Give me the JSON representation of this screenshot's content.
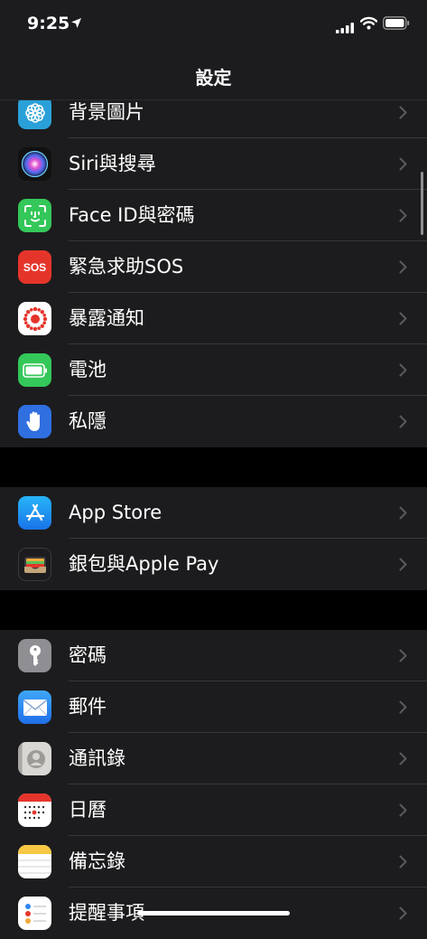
{
  "status_bar": {
    "time": "9:25"
  },
  "nav": {
    "title": "設定"
  },
  "groups": [
    {
      "items": [
        {
          "label": "背景圖片",
          "icon": "wallpaper-icon",
          "color": "#2aa0d8"
        },
        {
          "label": "Siri與搜尋",
          "icon": "siri-icon",
          "color": "#1c1c2e"
        },
        {
          "label": "Face ID與密碼",
          "icon": "face-id-icon",
          "color": "#34c759"
        },
        {
          "label": "緊急求助SOS",
          "icon": "sos-icon",
          "color": "#e5352b",
          "icon_text": "SOS"
        },
        {
          "label": "暴露通知",
          "icon": "exposure-notification-icon",
          "color": "#ffffff"
        },
        {
          "label": "電池",
          "icon": "battery-icon",
          "color": "#34c759"
        },
        {
          "label": "私隱",
          "icon": "privacy-hand-icon",
          "color": "#2f6fe0"
        }
      ]
    },
    {
      "items": [
        {
          "label": "App Store",
          "icon": "app-store-icon",
          "color": "#1d8cf0"
        },
        {
          "label": "銀包與Apple Pay",
          "icon": "wallet-icon",
          "color": "#1c1c1e"
        }
      ]
    },
    {
      "items": [
        {
          "label": "密碼",
          "icon": "key-icon",
          "color": "#8e8e93"
        },
        {
          "label": "郵件",
          "icon": "mail-icon",
          "color": "#2f86f0"
        },
        {
          "label": "通訊錄",
          "icon": "contacts-icon",
          "color": "#c8c6c2"
        },
        {
          "label": "日曆",
          "icon": "calendar-icon",
          "color": "#ffffff"
        },
        {
          "label": "備忘錄",
          "icon": "notes-icon",
          "color": "#ffffff"
        },
        {
          "label": "提醒事項",
          "icon": "reminders-icon",
          "color": "#ffffff"
        }
      ]
    }
  ]
}
